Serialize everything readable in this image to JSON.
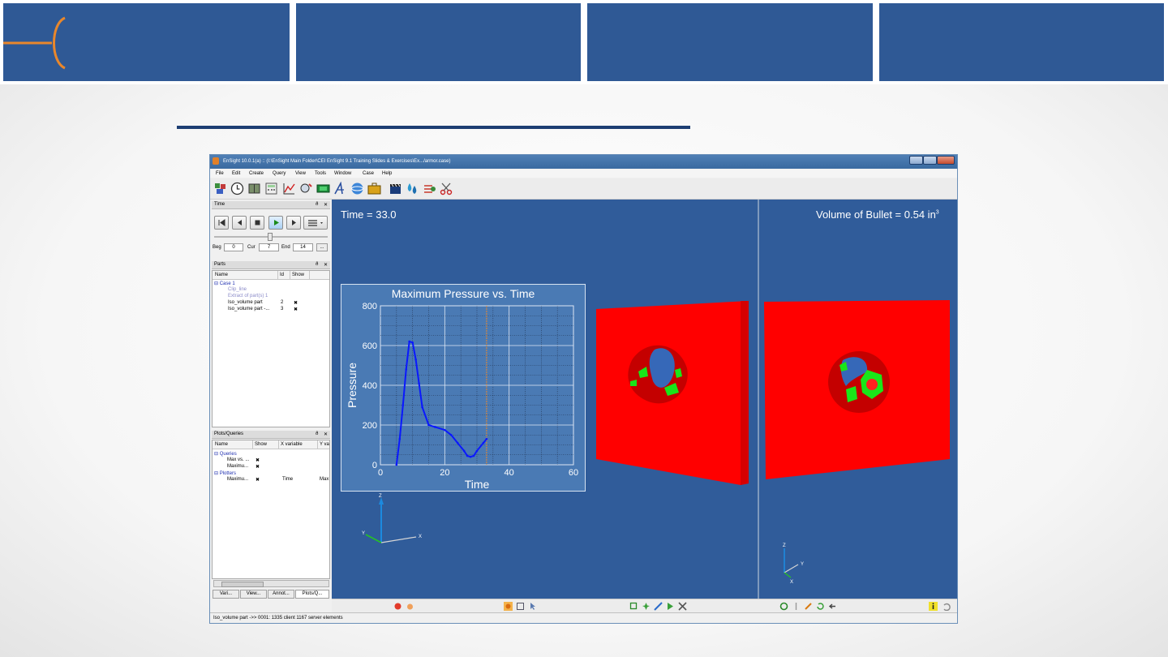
{
  "window": {
    "title": "EnSight 10.0.1(a) ::  (I:\\EnSight Main Folder\\CEI EnSight 9.1 Training Slides & Exercises\\Ex.../armor.case)"
  },
  "menu": [
    "File",
    "Edit",
    "Create",
    "Query",
    "View",
    "Tools",
    "Window",
    "Case",
    "Help"
  ],
  "toolbar_icons": [
    "parts-icon",
    "clock-icon",
    "book-icon",
    "calculator-icon",
    "plot-icon",
    "query-icon",
    "green-rectangle-icon",
    "annotation-icon",
    "sphere-icon",
    "toolbox-icon",
    "clapboard-icon",
    "droplets-icon",
    "flipbook-icon",
    "scissors-icon"
  ],
  "time_panel": {
    "title": "Time",
    "beg_label": "Beg",
    "beg": "0",
    "cur_label": "Cur",
    "cur": "7",
    "end_label": "End",
    "end": "14",
    "more": "...",
    "slider_position": 0.5
  },
  "parts_panel": {
    "title": "Parts",
    "columns": [
      "Name",
      "Id",
      "Show"
    ],
    "rows": [
      {
        "name": "Case 1",
        "id": "",
        "show": ""
      },
      {
        "name": "Clip_line",
        "id": "",
        "show": ""
      },
      {
        "name": "Extract of part(s) 1",
        "id": "",
        "show": ""
      },
      {
        "name": "Iso_volume part",
        "id": "2",
        "show": "✖"
      },
      {
        "name": "Iso_volume part -...",
        "id": "3",
        "show": "✖"
      }
    ]
  },
  "plots_panel": {
    "title": "Plots/Queries",
    "columns": [
      "Name",
      "Show",
      "X variable",
      "Y va"
    ],
    "queries_label": "Queries",
    "queries": [
      {
        "name": "Max vs. ...",
        "show": "✖"
      },
      {
        "name": "Maximu...",
        "show": "✖"
      }
    ],
    "plotters_label": "Plotters",
    "plotters": [
      {
        "name": "Maximu...",
        "show": "✖",
        "x": "Time",
        "y": "Max"
      }
    ]
  },
  "tabs": [
    "Vari...",
    "View...",
    "Annot...",
    "Plots/Q..."
  ],
  "viewport": {
    "time_text": "Time = 33.0",
    "volume_text": "Volume of Bullet = 0.54 in",
    "volume_sup": "3",
    "axis_labels": {
      "z": "Z",
      "x": "X",
      "y": "Y"
    }
  },
  "chart_data": {
    "type": "line",
    "title": "Maximum Pressure vs. Time",
    "xlabel": "Time",
    "ylabel": "Pressure",
    "xlim": [
      0,
      60
    ],
    "ylim": [
      0,
      800
    ],
    "xticks": [
      0,
      20,
      40,
      60
    ],
    "yticks": [
      0,
      200,
      400,
      600,
      800
    ],
    "grid": true,
    "current_time_marker": 33,
    "series": [
      {
        "color": "#0a18ff",
        "x": [
          5,
          6,
          7,
          8,
          9,
          10,
          11,
          12,
          13,
          15,
          17,
          20,
          22,
          24,
          26,
          27,
          28,
          29,
          30,
          32,
          33
        ],
        "y": [
          0,
          130,
          300,
          480,
          620,
          615,
          530,
          410,
          290,
          200,
          190,
          175,
          150,
          110,
          70,
          45,
          40,
          45,
          70,
          110,
          130
        ]
      }
    ]
  },
  "status_text": "Iso_volume part ->> 0001: 1335 client 1167 server elements",
  "colors": {
    "banner": "#2f5995",
    "accent": "#e9872b",
    "viewport": "#305c9a",
    "plot_bg": "#4a7ab4",
    "armor": "#ff0000",
    "damage_green": "#19e619"
  }
}
